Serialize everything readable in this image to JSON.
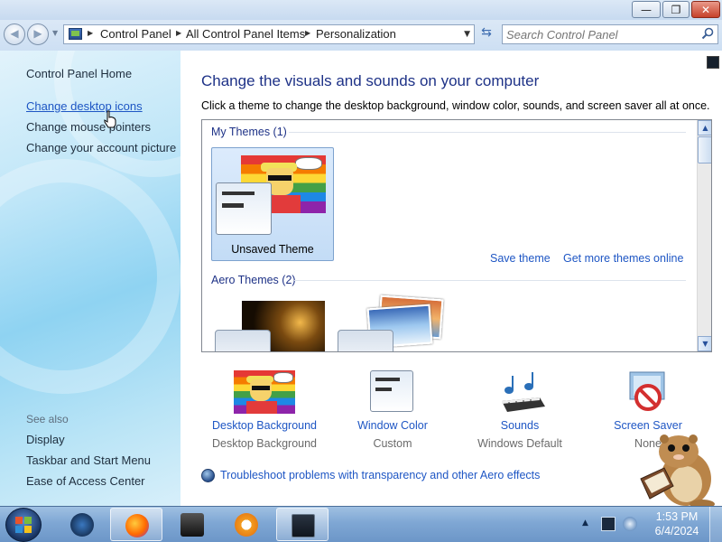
{
  "window": {
    "minimize_glyph": "—",
    "maximize_glyph": "❐",
    "close_glyph": "✕"
  },
  "address_bar": {
    "breadcrumbs": [
      "Control Panel",
      "All Control Panel Items",
      "Personalization"
    ],
    "search_placeholder": "Search Control Panel"
  },
  "left_pane": {
    "home": "Control Panel Home",
    "links": [
      "Change desktop icons",
      "Change mouse pointers",
      "Change your account picture"
    ],
    "see_also_label": "See also",
    "see_also": [
      "Display",
      "Taskbar and Start Menu",
      "Ease of Access Center"
    ]
  },
  "main": {
    "heading": "Change the visuals and sounds on your computer",
    "description": "Click a theme to change the desktop background, window color, sounds, and screen saver all at once.",
    "my_themes_label": "My Themes (1)",
    "selected_theme": "Unsaved Theme",
    "save_theme": "Save theme",
    "get_more_themes": "Get more themes online",
    "aero_themes_label": "Aero Themes (2)"
  },
  "bottom_items": [
    {
      "title": "Desktop Background",
      "value": "Desktop Background"
    },
    {
      "title": "Window Color",
      "value": "Custom"
    },
    {
      "title": "Sounds",
      "value": "Windows Default"
    },
    {
      "title": "Screen Saver",
      "value": "None"
    }
  ],
  "troubleshoot_link": "Troubleshoot problems with transparency and other Aero effects",
  "taskbar": {
    "time": "1:53 PM",
    "date": "6/4/2024"
  },
  "colors": {
    "link": "#1e56c4",
    "heading": "#1e3287",
    "taskbar": "#7fa7d4"
  }
}
